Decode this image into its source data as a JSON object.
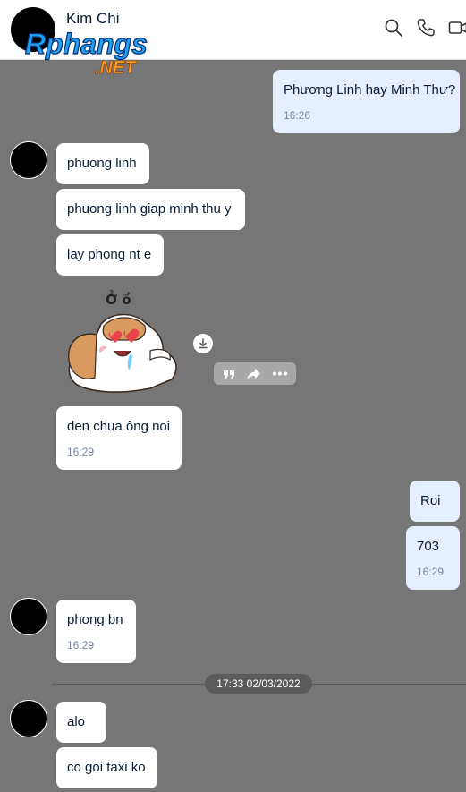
{
  "header": {
    "contact_name": "Kim Chi",
    "logo_text": "Rphangs",
    "logo_sub": ".NET",
    "icons": [
      "search-icon",
      "phone-icon",
      "video-icon"
    ]
  },
  "messages": {
    "m1": {
      "text": "Phương Linh hay Minh Thư?",
      "time": "16:26"
    },
    "m2": {
      "text": "phuong linh"
    },
    "m3": {
      "text": "phuong linh giap minh thu y"
    },
    "m4": {
      "text": "lay phong nt e"
    },
    "sticker_caption": "Ở ồ",
    "m5": {
      "text": "den chua ông noi",
      "time": "16:29"
    },
    "m6": {
      "text": "Roi"
    },
    "m7": {
      "text": "703",
      "time": "16:29"
    },
    "m8": {
      "text": "phong bn",
      "time": "16:29"
    },
    "date_separator": "17:33 02/03/2022",
    "m9": {
      "text": "alo"
    },
    "m10": {
      "text": "co goi taxi ko"
    }
  },
  "colors": {
    "background": "#767676",
    "incoming_bubble": "#ffffff",
    "outgoing_bubble": "#e5efff",
    "text": "#081c36",
    "time": "#7589a3"
  }
}
